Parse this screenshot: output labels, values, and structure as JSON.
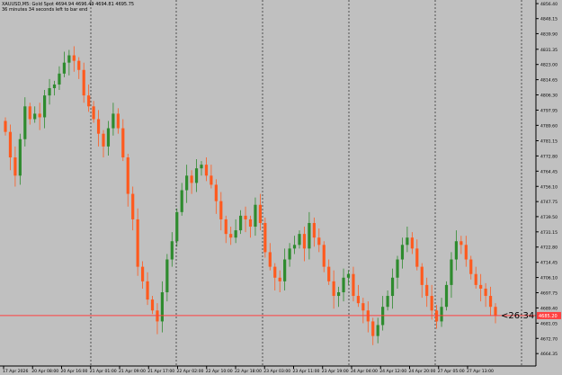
{
  "header": {
    "symbol_line": "XAUUSD,M5: Gold Spot 4694.94 4696.49 4694.81 4695.75",
    "timer_line": "36 minutes 34 seconds left to bar end"
  },
  "countdown": "<26:34",
  "chart_data": {
    "type": "candlestick",
    "symbol": "XAUUSD",
    "timeframe": "M5",
    "ylim": [
      4660.0,
      4856.4
    ],
    "y_ticks": [
      "4856.40",
      "4848.15",
      "4839.90",
      "4831.35",
      "4823.00",
      "4814.65",
      "4806.30",
      "4797.95",
      "4789.60",
      "4781.15",
      "4772.80",
      "4764.45",
      "4756.10",
      "4747.75",
      "4739.50",
      "4731.15",
      "4722.80",
      "4714.45",
      "4706.10",
      "4697.75",
      "4689.40",
      "4681.05",
      "4672.70",
      "4664.35"
    ],
    "x_ticks": [
      "17 Apr 2026",
      "20 Apr 08:00",
      "20 Apr 16:00",
      "21 Apr 01:00",
      "21 Apr 09:00",
      "21 Apr 17:00",
      "22 Apr 02:00",
      "22 Apr 10:00",
      "22 Apr 18:00",
      "23 Apr 03:00",
      "23 Apr 11:00",
      "23 Apr 19:00",
      "24 Apr 04:00",
      "24 Apr 12:00",
      "24 Apr 20:00",
      "27 Apr 05:00",
      "27 Apr 13:00"
    ],
    "current_price": 4685.2,
    "current_price_label": "4685.20",
    "bull_color": "#2e8b2e",
    "bear_color": "#ff5a1e",
    "current_line_color": "#ff4040",
    "candles_close": [
      4786,
      4772,
      4762,
      4782,
      4800,
      4793,
      4796,
      4794,
      4806,
      4810,
      4812,
      4818,
      4824,
      4828,
      4825,
      4820,
      4806,
      4800,
      4793,
      4785,
      4778,
      4788,
      4796,
      4788,
      4772,
      4752,
      4738,
      4712,
      4704,
      4694,
      4688,
      4682,
      4698,
      4716,
      4726,
      4742,
      4754,
      4762,
      4758,
      4766,
      4768,
      4762,
      4757,
      4748,
      4738,
      4730,
      4728,
      4732,
      4740,
      4738,
      4734,
      4746,
      4736,
      4720,
      4712,
      4706,
      4704,
      4716,
      4722,
      4724,
      4730,
      4722,
      4736,
      4728,
      4724,
      4712,
      4704,
      4696,
      4698,
      4706,
      4708,
      4696,
      4692,
      4688,
      4682,
      4674,
      4680,
      4690,
      4696,
      4706,
      4716,
      4724,
      4728,
      4722,
      4712,
      4702,
      4696,
      4688,
      4682,
      4690,
      4702,
      4716,
      4726,
      4724,
      4716,
      4708,
      4702,
      4700,
      4696,
      4690,
      4685
    ],
    "grid": true
  }
}
